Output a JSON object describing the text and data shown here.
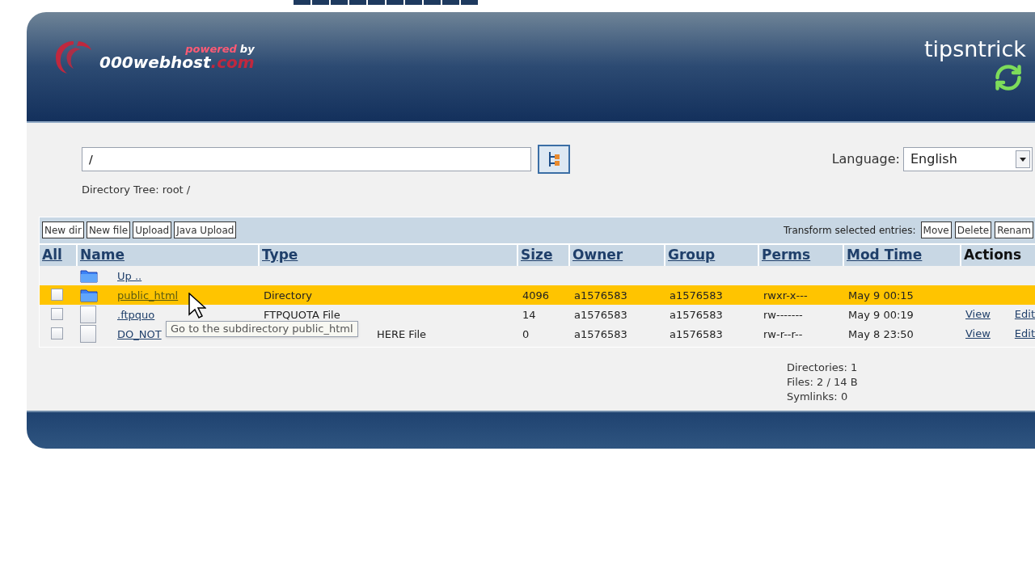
{
  "header": {
    "powered": "powered",
    "by": "by",
    "brand": "000webhost",
    "brand_tld": ".com",
    "site": "tipsntrick"
  },
  "path_field": {
    "value": "/"
  },
  "directory_tree": "Directory Tree: root /",
  "language": {
    "label": "Language:",
    "value": "English"
  },
  "toolbar": {
    "buttons": [
      "New dir",
      "New file",
      "Upload",
      "Java Upload"
    ],
    "transform_label": "Transform selected entries:",
    "transform_buttons": [
      "Move",
      "Delete",
      "Renam"
    ]
  },
  "columns": [
    "All",
    "Name",
    "Type",
    "Size",
    "Owner",
    "Group",
    "Perms",
    "Mod Time",
    "Actions"
  ],
  "rows": [
    {
      "kind": "up",
      "name": "Up ..",
      "selected": false
    },
    {
      "kind": "dir",
      "name": "public_html",
      "type": "Directory",
      "size": "4096",
      "owner": "a1576583",
      "group": "a1576583",
      "perms": "rwxr-x---",
      "mod_time": "May 9 00:15",
      "actions": [],
      "checked": false,
      "selected": true
    },
    {
      "kind": "file",
      "name": ".ftpquo",
      "type": "FTPQUOTA File",
      "size": "14",
      "owner": "a1576583",
      "group": "a1576583",
      "perms": "rw-------",
      "mod_time": "May 9 00:19",
      "actions": [
        "View",
        "Edit"
      ],
      "checked": false,
      "selected": false
    },
    {
      "kind": "file",
      "name": "DO_NOT",
      "type": "HERE File",
      "type_partial": true,
      "size": "0",
      "owner": "a1576583",
      "group": "a1576583",
      "perms": "rw-r--r--",
      "mod_time": "May 8 23:50",
      "actions": [
        "View",
        "Edit"
      ],
      "checked": false,
      "selected": false
    }
  ],
  "tooltip": "Go to the subdirectory public_html",
  "summary": [
    "Directories: 1",
    "Files: 2 / 14 B",
    "Symlinks: 0"
  ]
}
